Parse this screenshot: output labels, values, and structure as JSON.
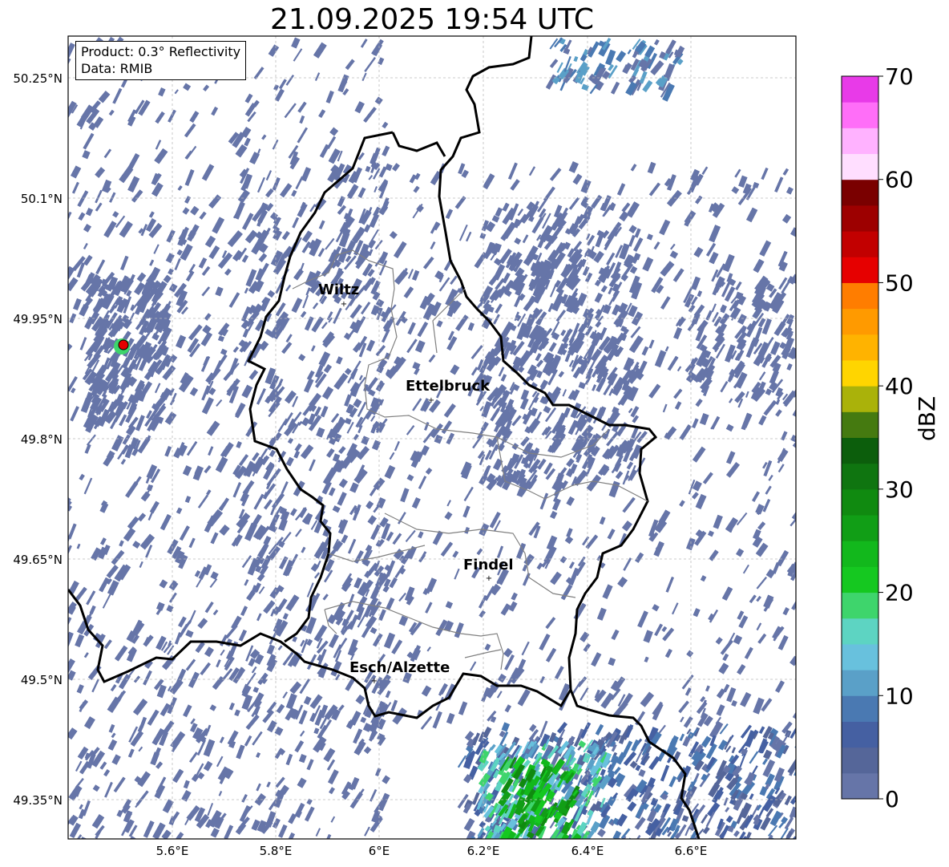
{
  "title": "21.09.2025 19:54 UTC",
  "info": {
    "product": "Product: 0.3° Reflectivity",
    "data": "Data: RMIB"
  },
  "lat_labels": [
    "50.25°N",
    "50.1°N",
    "49.95°N",
    "49.8°N",
    "49.65°N",
    "49.5°N",
    "49.35°N"
  ],
  "lon_labels": [
    "5.6°E",
    "5.8°E",
    "6°E",
    "6.2°E",
    "6.4°E",
    "6.6°E"
  ],
  "cities": [
    {
      "name": "Wiltz"
    },
    {
      "name": "Ettelbruck"
    },
    {
      "name": "Findel"
    },
    {
      "name": "Esch/Alzette"
    }
  ],
  "colorbar": {
    "label": "dBZ",
    "ticks": [
      "0",
      "10",
      "20",
      "30",
      "40",
      "50",
      "60",
      "70"
    ],
    "colors": [
      "#6675a8",
      "#556699",
      "#4560a2",
      "#4a79b2",
      "#5aa0c8",
      "#68c1dd",
      "#5dd4c2",
      "#3ed56c",
      "#15c820",
      "#12b81c",
      "#119e16",
      "#108a10",
      "#0f7510",
      "#0c5e0c",
      "#457a10",
      "#aab20a",
      "#ffd500",
      "#ffb300",
      "#ff9a00",
      "#ff7d00",
      "#e60000",
      "#c20000",
      "#9d0000",
      "#7a0000",
      "#ffdeff",
      "#ffb2ff",
      "#ff6ef8",
      "#e83ae8"
    ]
  }
}
